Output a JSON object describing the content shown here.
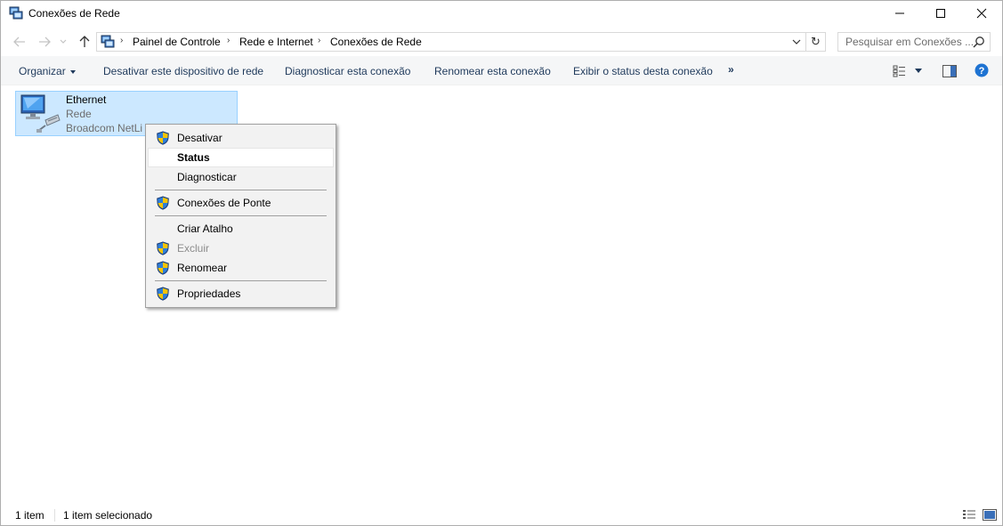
{
  "window": {
    "title": "Conexões de Rede"
  },
  "address": {
    "crumbs": [
      "Painel de Controle",
      "Rede e Internet",
      "Conexões de Rede"
    ],
    "search_placeholder": "Pesquisar em Conexões ..."
  },
  "commands": {
    "organize": "Organizar",
    "disable_device": "Desativar este dispositivo de rede",
    "diagnose": "Diagnosticar esta conexão",
    "rename": "Renomear esta conexão",
    "view_status": "Exibir o status desta conexão",
    "more": "»"
  },
  "item": {
    "name": "Ethernet",
    "network": "Rede",
    "adapter": "Broadcom NetLi"
  },
  "context_menu": {
    "items": [
      {
        "label": "Desativar",
        "shield": true
      },
      {
        "label": "Status",
        "bold": true,
        "hover": true
      },
      {
        "label": "Diagnosticar"
      },
      {
        "label": "Conexões de Ponte",
        "shield": true
      },
      {
        "label": "Criar Atalho"
      },
      {
        "label": "Excluir",
        "shield": true,
        "disabled": true
      },
      {
        "label": "Renomear",
        "shield": true
      },
      {
        "label": "Propriedades",
        "shield": true
      }
    ]
  },
  "status": {
    "count": "1 item",
    "selected": "1 item selecionado"
  },
  "colors": {
    "selection_bg": "#cce8ff",
    "selection_border": "#99d1ff",
    "command_text": "#1e395b",
    "help_blue": "#1e73d2"
  }
}
